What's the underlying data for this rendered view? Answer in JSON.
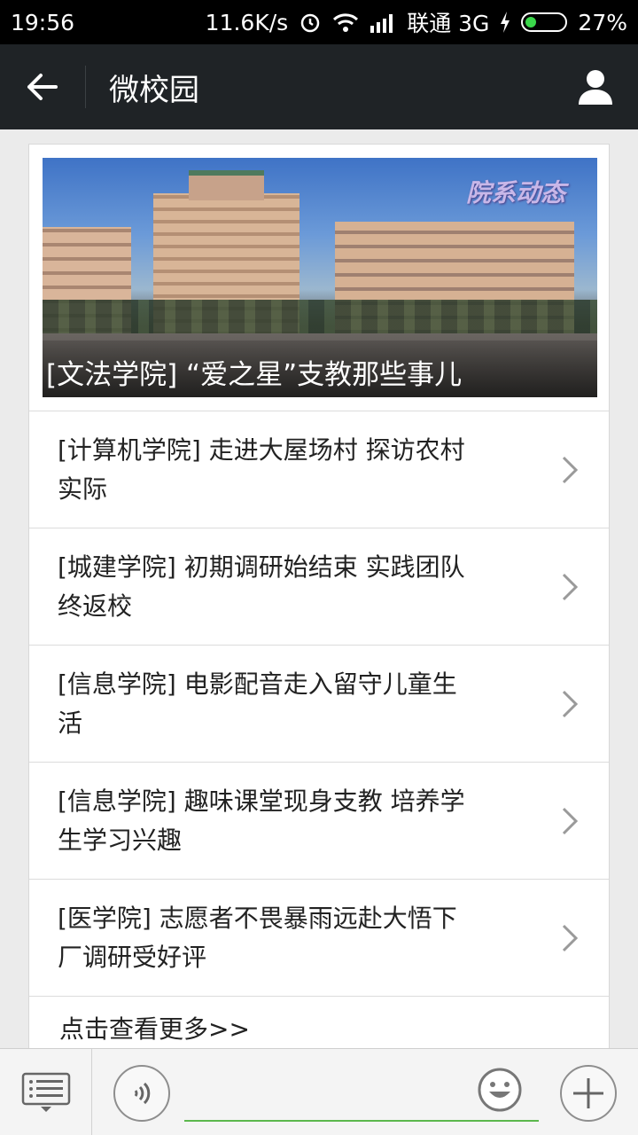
{
  "status_bar": {
    "time": "19:56",
    "speed": "11.6K/s",
    "carrier": "联通 3G",
    "battery": "27%"
  },
  "header": {
    "title": "微校园"
  },
  "hero": {
    "tag": "院系动态",
    "caption": "[文法学院] “爱之星”支教那些事儿"
  },
  "news": [
    {
      "title": "[计算机学院] 走进大屋场村 探访农村实际"
    },
    {
      "title": "[城建学院] 初期调研始结束 实践团队终返校"
    },
    {
      "title": "[信息学院] 电影配音走入留守儿童生活"
    },
    {
      "title": "[信息学院] 趣味课堂现身支教 培养学生学习兴趣"
    },
    {
      "title": "[医学院] 志愿者不畏暴雨远赴大悟下厂调研受好评"
    }
  ],
  "more_label": "点击查看更多>>",
  "colors": {
    "header_bg": "#1f2326",
    "input_underline": "#5bb84d",
    "page_bg": "#ebebeb"
  },
  "icons": {
    "back": "back-arrow-icon",
    "profile": "person-icon",
    "menu": "list-menu-icon",
    "voice": "voice-icon",
    "emoji": "emoji-icon",
    "plus": "plus-icon"
  }
}
